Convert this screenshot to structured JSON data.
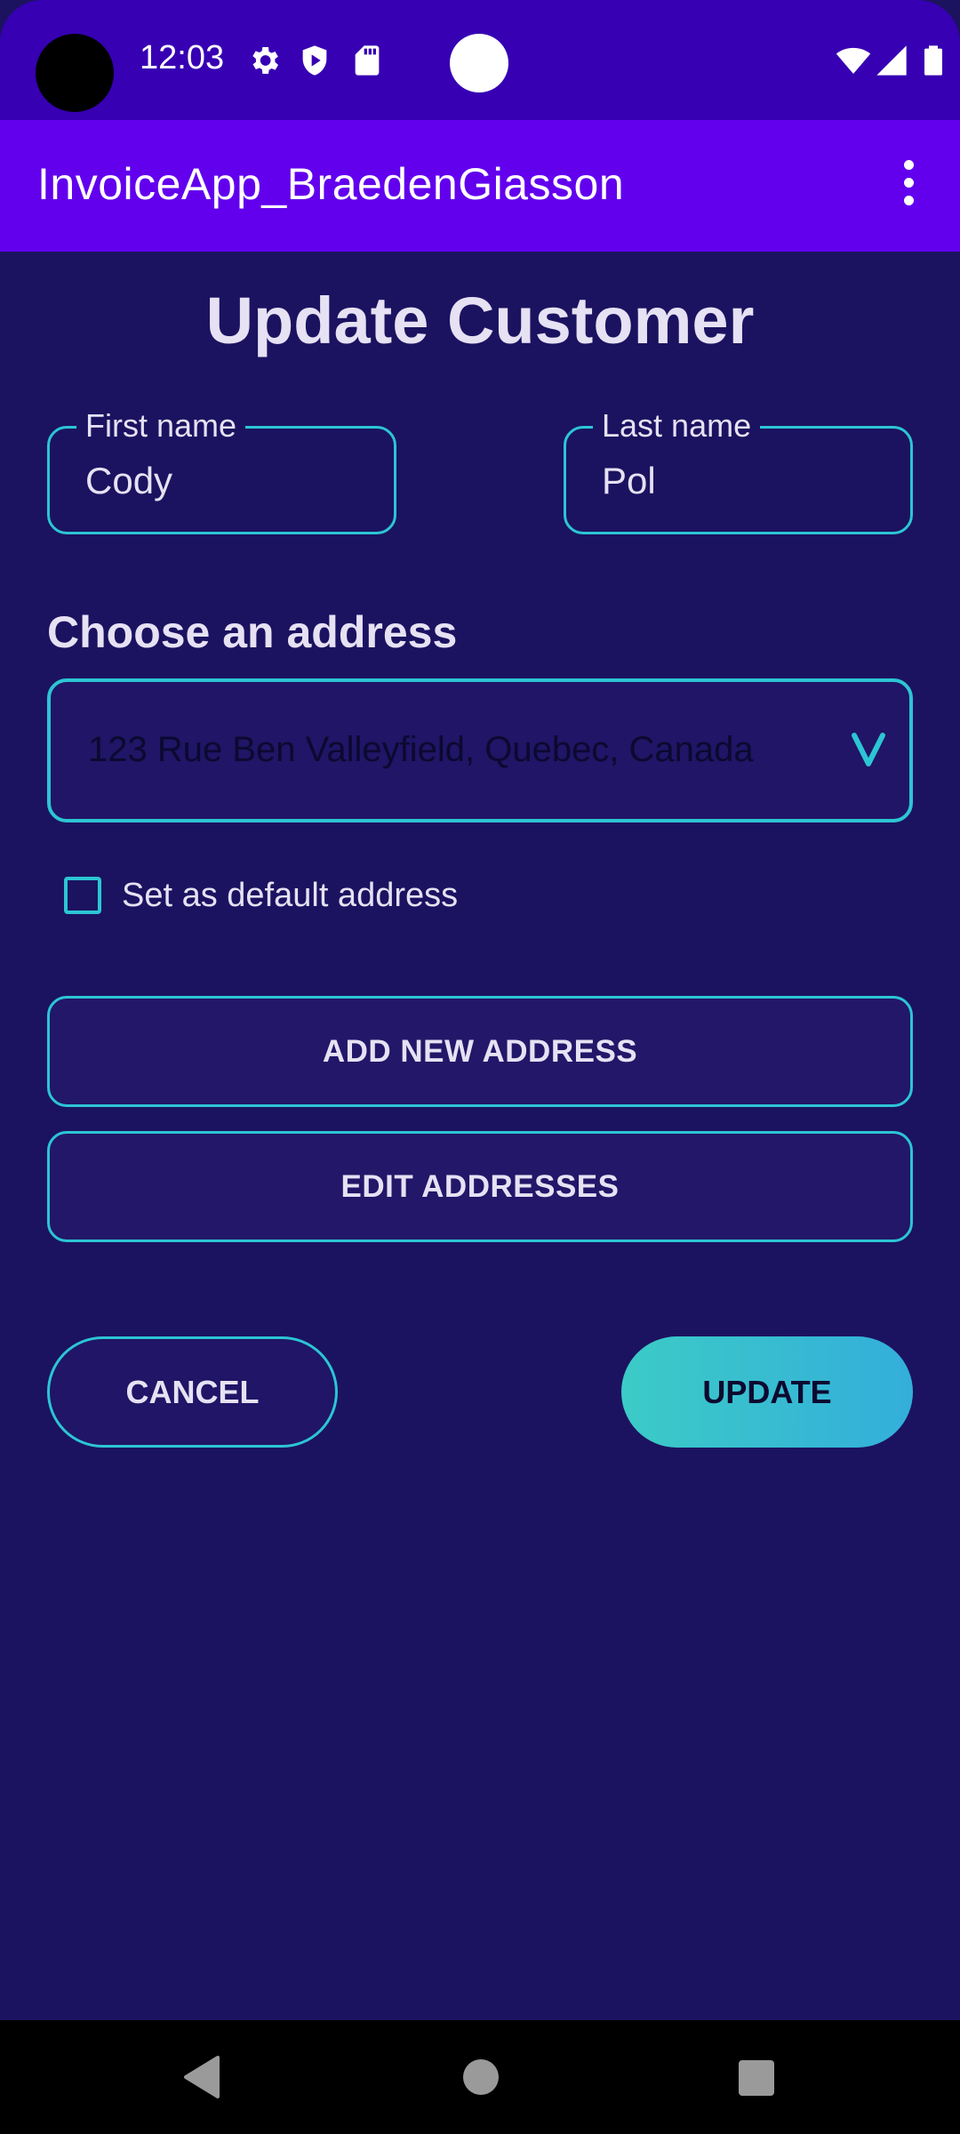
{
  "status_bar": {
    "time": "12:03",
    "icons": [
      "settings-icon",
      "shield-icon",
      "sd-card-icon",
      "wifi-icon",
      "signal-icon",
      "battery-icon"
    ]
  },
  "app_bar": {
    "title": "InvoiceApp_BraedenGiasson",
    "menu_icon": "overflow-menu-icon"
  },
  "form": {
    "title": "Update Customer",
    "first_name": {
      "label": "First name",
      "value": "Cody"
    },
    "last_name": {
      "label": "Last name",
      "value": "Pol"
    },
    "address_section_label": "Choose an address",
    "address_selected": "123 Rue Ben Valleyfield, Quebec, Canada",
    "default_checkbox": {
      "label": "Set as default address",
      "checked": false
    },
    "add_address_label": "ADD NEW ADDRESS",
    "edit_addresses_label": "EDIT ADDRESSES",
    "cancel_label": "CANCEL",
    "update_label": "UPDATE"
  },
  "colors": {
    "background": "#1b1360",
    "status_bar": "#3700b3",
    "app_bar": "#6200ee",
    "accent": "#2cc5d4"
  },
  "nav_bar": {
    "icons": [
      "back-icon",
      "home-icon",
      "recents-icon"
    ]
  }
}
